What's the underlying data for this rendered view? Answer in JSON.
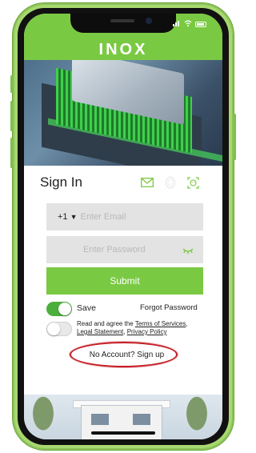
{
  "app": {
    "logo_text": "INOX"
  },
  "colors": {
    "brand_green": "#7ac943",
    "toggle_on": "#4caf3c",
    "highlight_red": "#c41e26",
    "field_bg": "#e3e3e3"
  },
  "signin": {
    "title": "Sign In",
    "methods": [
      {
        "icon": "envelope-icon",
        "active": true
      },
      {
        "icon": "fingerprint-icon",
        "active": false
      },
      {
        "icon": "face-id-icon",
        "active": false
      }
    ]
  },
  "form": {
    "country_code": "+1",
    "email_placeholder": "Enter Email",
    "password_placeholder": "Enter Password",
    "submit_label": "Submit",
    "save_label": "Save",
    "save_enabled": true,
    "forgot_label": "Forgot Password",
    "agree_enabled": false,
    "agree_prefix": "Read and agree the ",
    "terms_label": "Terms of Services",
    "legal_label": "Legal Statement",
    "privacy_label": "Privacy Policy",
    "signup_label": "No Account? Sign up"
  }
}
